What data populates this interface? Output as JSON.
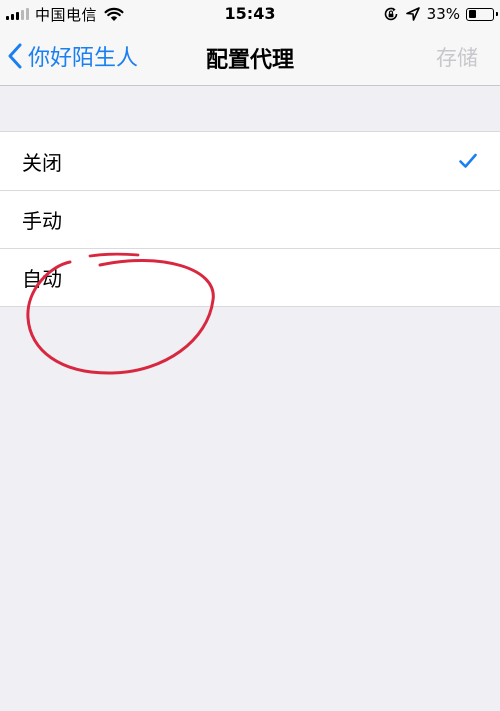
{
  "status_bar": {
    "carrier": "中国电信",
    "time": "15:43",
    "battery_percent": "33%",
    "battery_level": 0.33,
    "signal_bars_on": 3,
    "signal_bars_total": 5
  },
  "nav": {
    "back_label": "你好陌生人",
    "title": "配置代理",
    "save_label": "存储"
  },
  "options": [
    {
      "label": "关闭",
      "selected": true
    },
    {
      "label": "手动",
      "selected": false
    },
    {
      "label": "自动",
      "selected": false
    }
  ],
  "colors": {
    "accent": "#1a7ff0",
    "background": "#efeff4",
    "annotation": "#d8283f",
    "disabled": "#c7c7cc"
  },
  "icons": [
    "wifi-icon",
    "rotation-lock-icon",
    "location-icon",
    "battery-icon",
    "chevron-left-icon",
    "checkmark-icon"
  ]
}
